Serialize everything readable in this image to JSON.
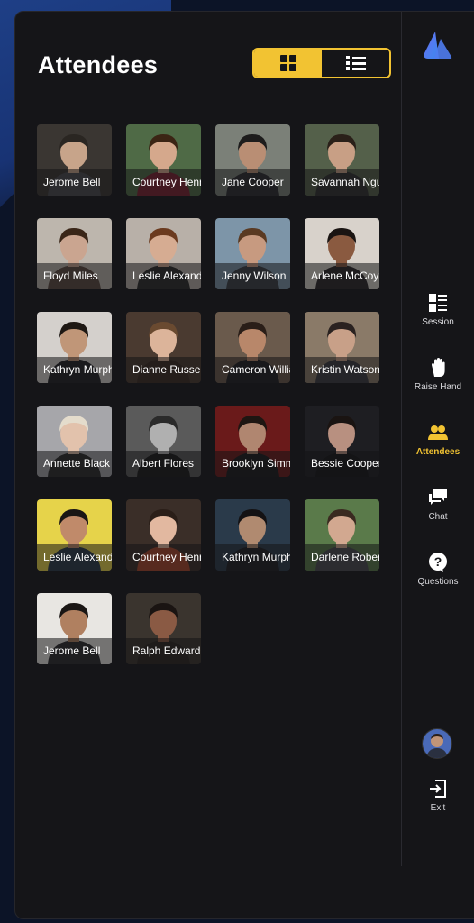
{
  "panel": {
    "title": "Attendees"
  },
  "view_toggle": {
    "grid_icon": "grid-icon",
    "list_icon": "list-icon",
    "active": "grid"
  },
  "attendees": [
    {
      "name": "Jerome Bell",
      "bg": "#3a3632",
      "skin": "#c7a48a",
      "hair": "#2a2622",
      "shirt": "#4a4a4e"
    },
    {
      "name": "Courtney Henry",
      "bg": "#4f6a46",
      "skin": "#d5a88c",
      "hair": "#3b2414",
      "shirt": "#7a2030"
    },
    {
      "name": "Jane Cooper",
      "bg": "#7b8078",
      "skin": "#b98e74",
      "hair": "#1d1c1c",
      "shirt": "#2b2b30"
    },
    {
      "name": "Savannah Nguyen",
      "bg": "#54604a",
      "skin": "#c89f85",
      "hair": "#2a2019",
      "shirt": "#30302f"
    },
    {
      "name": "Floyd Miles",
      "bg": "#bdb6ad",
      "skin": "#caa590",
      "hair": "#3a2618",
      "shirt": "#5c4a42"
    },
    {
      "name": "Leslie Alexander",
      "bg": "#b8b0a8",
      "skin": "#d6ac92",
      "hair": "#6b3a1e",
      "shirt": "#2a2a2a"
    },
    {
      "name": "Jenny Wilson",
      "bg": "#7d95a8",
      "skin": "#c79a80",
      "hair": "#5a3a22",
      "shirt": "#3a3f46"
    },
    {
      "name": "Arlene McCoy",
      "bg": "#d8d2cb",
      "skin": "#8a5a40",
      "hair": "#1a1412",
      "shirt": "#2a2628"
    },
    {
      "name": "Kathryn Murphy",
      "bg": "#d4d0cc",
      "skin": "#c09678",
      "hair": "#1e1814",
      "shirt": "#202024"
    },
    {
      "name": "Dianne Russell",
      "bg": "#4a3a30",
      "skin": "#dcb49a",
      "hair": "#6a4a30",
      "shirt": "#3a2a22"
    },
    {
      "name": "Cameron Williamson",
      "bg": "#6a5a4c",
      "skin": "#b8876a",
      "hair": "#2a1e18",
      "shirt": "#1e1e22"
    },
    {
      "name": "Kristin Watson",
      "bg": "#8a7a68",
      "skin": "#c8a088",
      "hair": "#2a2220",
      "shirt": "#3a3a40"
    },
    {
      "name": "Annette Black",
      "bg": "#a6a6aa",
      "skin": "#e2c2ac",
      "hair": "#e4dccc",
      "shirt": "#2a2a2c"
    },
    {
      "name": "Albert Flores",
      "bg": "#5a5a5a",
      "skin": "#b0b0b0",
      "hair": "#2a2a2a",
      "shirt": "#1a1a1a"
    },
    {
      "name": "Brooklyn Simmons",
      "bg": "#6a1a1a",
      "skin": "#b08670",
      "hair": "#1e1612",
      "shirt": "#1a1a1c"
    },
    {
      "name": "Bessie Cooper",
      "bg": "#1e1e22",
      "skin": "#b89080",
      "hair": "#1a1412",
      "shirt": "#151518"
    },
    {
      "name": "Leslie Alexander",
      "bg": "#e6d34a",
      "skin": "#c08a6a",
      "hair": "#1a1614",
      "shirt": "#2b3a4a"
    },
    {
      "name": "Courtney Henry",
      "bg": "#3a2e28",
      "skin": "#e2b8a0",
      "hair": "#2a1e18",
      "shirt": "#a8452a"
    },
    {
      "name": "Kathryn Murphy",
      "bg": "#2a3a4a",
      "skin": "#b08a70",
      "hair": "#141214",
      "shirt": "#1e1e22"
    },
    {
      "name": "Darlene Robertson",
      "bg": "#5a7a4a",
      "skin": "#d2a890",
      "hair": "#3a2a20",
      "shirt": "#4a4a50"
    },
    {
      "name": "Jerome Bell",
      "bg": "#e8e6e2",
      "skin": "#b08060",
      "hair": "#1a1614",
      "shirt": "#2a2a2e"
    },
    {
      "name": "Ralph Edwards",
      "bg": "#3a342e",
      "skin": "#8a5a44",
      "hair": "#1a1412",
      "shirt": "#2a2420"
    }
  ],
  "sidebar": {
    "logo": "app-logo",
    "items": [
      {
        "key": "session",
        "label": "Session",
        "icon": "session-icon"
      },
      {
        "key": "raise_hand",
        "label": "Raise Hand",
        "icon": "hand-icon"
      },
      {
        "key": "attendees",
        "label": "Attendees",
        "icon": "users-icon",
        "active": true
      },
      {
        "key": "chat",
        "label": "Chat",
        "icon": "chat-icon"
      },
      {
        "key": "questions",
        "label": "Questions",
        "icon": "question-icon"
      }
    ],
    "exit_label": "Exit"
  },
  "colors": {
    "accent": "#f2c332",
    "panel": "#151518",
    "background": "#0c1427"
  }
}
